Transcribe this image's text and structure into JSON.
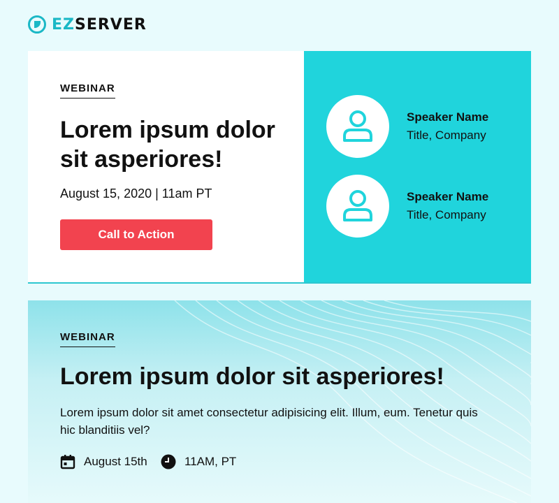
{
  "brand": {
    "prefix": "EZ",
    "suffix": "SERVER"
  },
  "card1": {
    "eyebrow": "WEBINAR",
    "title": "Lorem ipsum dolor sit asperiores!",
    "date": "August 15, 2020 | 11am PT",
    "cta_label": "Call to Action",
    "speakers": [
      {
        "name": "Speaker Name",
        "title": "Title, Company"
      },
      {
        "name": "Speaker Name",
        "title": "Title, Company"
      }
    ]
  },
  "card2": {
    "eyebrow": "WEBINAR",
    "title": "Lorem ipsum dolor sit asperiores!",
    "body": "Lorem ipsum dolor sit amet consectetur adipisicing elit. Illum, eum. Tenetur quis hic blanditiis vel?",
    "date": "August 15th",
    "time": "11AM, PT"
  },
  "colors": {
    "accent": "#20d4dc",
    "cta": "#f2434f",
    "background": "#e8fbfd"
  },
  "icons": {
    "logo": "ez-logo-icon",
    "avatar": "user-icon",
    "date": "calendar-icon",
    "time": "clock-icon"
  }
}
